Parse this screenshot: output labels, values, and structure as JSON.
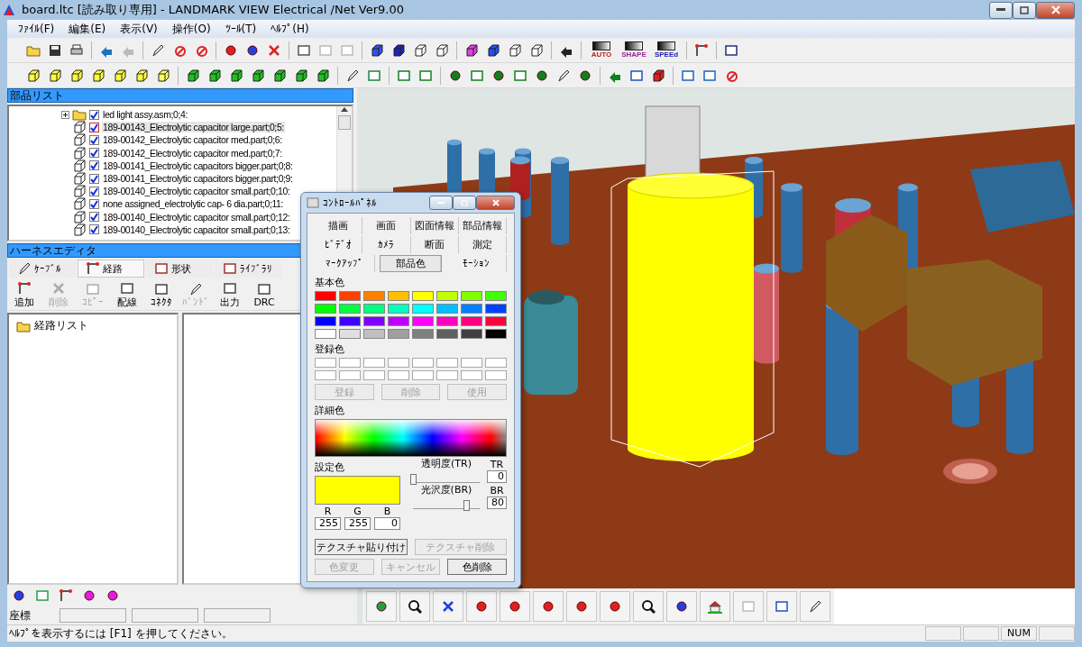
{
  "window": {
    "title": "board.ltc [読み取り専用] - LANDMARK VIEW Electrical /Net Ver9.00"
  },
  "menu": [
    {
      "label": "ﾌｧｲﾙ(F)"
    },
    {
      "label": "編集(E)"
    },
    {
      "label": "表示(V)"
    },
    {
      "label": "操作(O)"
    },
    {
      "label": "ﾂｰﾙ(T)"
    },
    {
      "label": "ﾍﾙﾌﾟ(H)"
    }
  ],
  "toolbar": {
    "badge_labels": [
      "AUTO",
      "SHAPE",
      "SPEEd"
    ]
  },
  "parts_list": {
    "title": "部品リスト",
    "items": [
      {
        "kind": "assembly",
        "label": "led light assy.asm;0;4:",
        "checked": true,
        "selected": false,
        "expanded": false
      },
      {
        "kind": "part",
        "label": "189-00143_Electrolytic capacitor large.part;0;5:",
        "checked": true,
        "selected": true
      },
      {
        "kind": "part",
        "label": "189-00142_Electrolytic capacitor med.part;0;6:",
        "checked": true,
        "selected": false
      },
      {
        "kind": "part",
        "label": "189-00142_Electrolytic capacitor med.part;0;7:",
        "checked": true,
        "selected": false
      },
      {
        "kind": "part",
        "label": "189-00141_Electrolytic capacitors bigger.part;0;8:",
        "checked": true,
        "selected": false
      },
      {
        "kind": "part",
        "label": "189-00141_Electrolytic capacitors bigger.part;0;9:",
        "checked": true,
        "selected": false
      },
      {
        "kind": "part",
        "label": "189-00140_Electrolytic capacitor small.part;0;10:",
        "checked": true,
        "selected": false
      },
      {
        "kind": "part",
        "label": "none assigned_electrolytic  cap- 6 dia.part;0;11:",
        "checked": true,
        "selected": false
      },
      {
        "kind": "part",
        "label": "189-00140_Electrolytic capacitor small.part;0;12:",
        "checked": true,
        "selected": false
      },
      {
        "kind": "part",
        "label": "189-00140_Electrolytic capacitor small.part;0;13:",
        "checked": true,
        "selected": false
      }
    ]
  },
  "harness_editor": {
    "title": "ハーネスエディタ",
    "tabs": [
      {
        "label": "ｹｰﾌﾞﾙ",
        "selected": false
      },
      {
        "label": "経路",
        "selected": true
      },
      {
        "label": "形状",
        "selected": false
      },
      {
        "label": "ﾗｲﾌﾞﾗﾘ",
        "selected": false
      }
    ],
    "tools": [
      {
        "label": "追加",
        "disabled": false
      },
      {
        "label": "削除",
        "disabled": true
      },
      {
        "label": "ｺﾋﾟｰ",
        "disabled": true
      },
      {
        "label": "配線",
        "disabled": false
      },
      {
        "label": "ｺﾈｸﾀ",
        "disabled": false
      },
      {
        "label": "ﾊﾞﾝﾄﾞ",
        "disabled": true
      },
      {
        "label": "出力",
        "disabled": false
      },
      {
        "label": "DRC",
        "disabled": false
      }
    ],
    "route_tree": [
      {
        "label": "経路リスト"
      }
    ],
    "coordinate_label": "座標"
  },
  "control_panel": {
    "title": "ｺﾝﾄﾛｰﾙﾊﾟﾈﾙ",
    "tab_rows": [
      [
        {
          "label": "描画",
          "selected": false
        },
        {
          "label": "画面",
          "selected": false
        },
        {
          "label": "図面情報",
          "selected": false
        },
        {
          "label": "部品情報",
          "selected": false
        }
      ],
      [
        {
          "label": "ﾋﾞﾃﾞｵ",
          "selected": false
        },
        {
          "label": "ｶﾒﾗ",
          "selected": false
        },
        {
          "label": "断面",
          "selected": false
        },
        {
          "label": "測定",
          "selected": false
        }
      ],
      [
        {
          "label": "ﾏｰｸｱｯﾌﾟ",
          "selected": false
        },
        {
          "label": "部品色",
          "selected": true
        },
        {
          "label": "ﾓｰｼｮﾝ",
          "selected": false
        }
      ]
    ],
    "basic_colors_label": "基本色",
    "basic_colors": [
      {
        "color": "#ff0000"
      },
      {
        "color": "#ff4000"
      },
      {
        "color": "#ff8000"
      },
      {
        "color": "#ffbf00"
      },
      {
        "color": "#ffff00"
      },
      {
        "color": "#bfff00"
      },
      {
        "color": "#80ff00"
      },
      {
        "color": "#40ff00"
      },
      {
        "color": "#00ff00"
      },
      {
        "color": "#00ff40"
      },
      {
        "color": "#00ff80"
      },
      {
        "color": "#00ffbf"
      },
      {
        "color": "#00ffff"
      },
      {
        "color": "#00bfff"
      },
      {
        "color": "#0080ff"
      },
      {
        "color": "#0040ff"
      },
      {
        "color": "#0000ff"
      },
      {
        "color": "#4000ff"
      },
      {
        "color": "#8000ff"
      },
      {
        "color": "#bf00ff"
      },
      {
        "color": "#ff00ff"
      },
      {
        "color": "#ff00bf"
      },
      {
        "color": "#ff0080"
      },
      {
        "color": "#ff0040"
      },
      {
        "color": "#ffffff"
      },
      {
        "color": "#dfdfdf"
      },
      {
        "color": "#bfbfbf"
      },
      {
        "color": "#9f9f9f"
      },
      {
        "color": "#7f7f7f"
      },
      {
        "color": "#5f5f5f"
      },
      {
        "color": "#3f3f3f"
      },
      {
        "color": "#000000"
      }
    ],
    "registered_colors_label": "登録色",
    "registered_buttons": [
      {
        "label": "登録",
        "disabled": true
      },
      {
        "label": "削除",
        "disabled": true
      },
      {
        "label": "使用",
        "disabled": true
      }
    ],
    "detail_colors_label": "詳細色",
    "set_color_label": "設定色",
    "rgb": [
      {
        "label": "R",
        "value": "255"
      },
      {
        "label": "G",
        "value": "255"
      },
      {
        "label": "B",
        "value": "0"
      }
    ],
    "sliders": [
      {
        "label": "透明度(TR)",
        "short": "TR",
        "value": "0",
        "level": 0
      },
      {
        "label": "光沢度(BR)",
        "short": "BR",
        "value": "80",
        "level": 0.8
      }
    ],
    "buttons": [
      {
        "label": "テクスチャ貼り付け",
        "disabled": false
      },
      {
        "label": "テクスチャ削除",
        "disabled": true
      },
      {
        "label": "色変更",
        "disabled": true
      },
      {
        "label": "キャンセル",
        "disabled": true
      },
      {
        "label": "色削除",
        "disabled": false
      }
    ]
  },
  "status_bar": {
    "text": "ﾍﾙﾌﾟを表示するには [F1] を押してください。",
    "indicators": [
      "NUM"
    ]
  }
}
